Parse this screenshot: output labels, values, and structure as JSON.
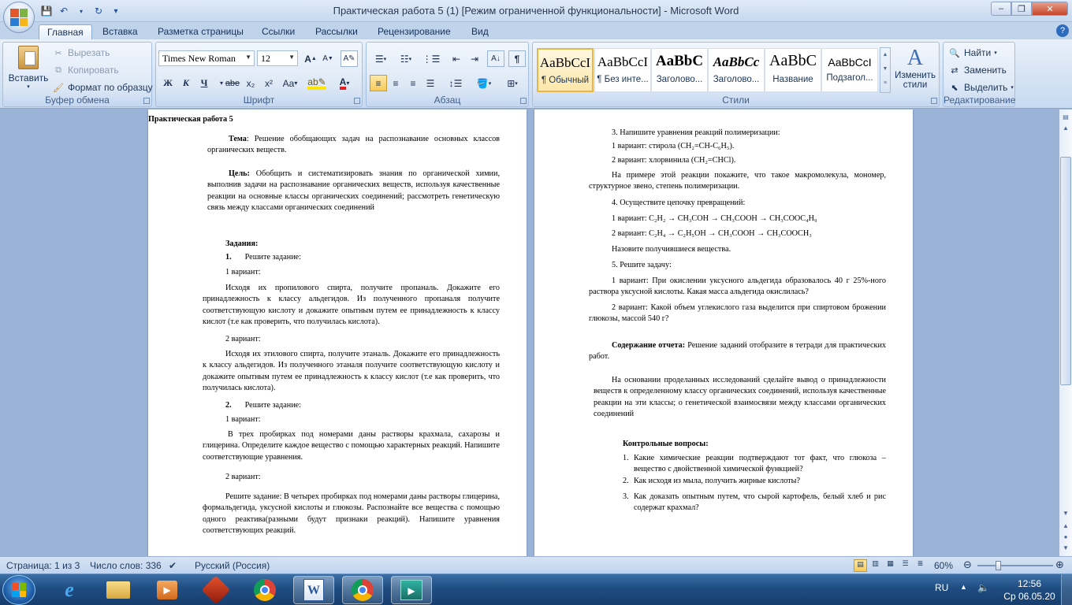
{
  "window": {
    "title": "Практическая работа 5 (1) [Режим ограниченной функциональности] - Microsoft Word",
    "min": "‒",
    "max": "❐",
    "close": "✕"
  },
  "qat": {
    "save": "💾",
    "undo": "↶",
    "redo": "↻",
    "customize": "▾"
  },
  "tabs": [
    "Главная",
    "Вставка",
    "Разметка страницы",
    "Ссылки",
    "Рассылки",
    "Рецензирование",
    "Вид"
  ],
  "clipboard": {
    "paste": "Вставить",
    "cut": "Вырезать",
    "copy": "Копировать",
    "format_painter": "Формат по образцу",
    "label": "Буфер обмена"
  },
  "font": {
    "name": "Times New Roman",
    "size": "12",
    "label": "Шрифт",
    "bold": "Ж",
    "italic": "К",
    "underline": "Ч",
    "strike": "abe",
    "sub": "x₂",
    "sup": "x²",
    "case": "Aa",
    "grow": "A",
    "shrink": "A"
  },
  "paragraph": {
    "label": "Абзац"
  },
  "styles": {
    "label": "Стили",
    "items": [
      {
        "preview": "AaBbCcI",
        "name": "¶ Обычный"
      },
      {
        "preview": "AaBbCcI",
        "name": "¶ Без инте..."
      },
      {
        "preview": "AaBbC",
        "name": "Заголово..."
      },
      {
        "preview": "AaBbCc",
        "name": "Заголово..."
      },
      {
        "preview": "AaBbC",
        "name": "Название"
      },
      {
        "preview": "AaBbCcI",
        "name": "Подзагол..."
      }
    ],
    "change": "Изменить стили"
  },
  "editing": {
    "find": "Найти",
    "replace": "Заменить",
    "select": "Выделить",
    "label": "Редактирование"
  },
  "page1": {
    "title": "Практическая работа 5",
    "topic_label": "Тема",
    "topic": ": Решение обобщающих задач на распознавание основных классов органических веществ.",
    "goal_label": "Цель:",
    "goal": " Обобщить и систематизировать знания по органической химии, выполнив задачи на распознавание органических веществ, используя качественные реакции на основные классы органических соединений; рассмотреть генетическую связь между классами органических соединений",
    "tasks": "Задания:",
    "t1_num": "1.",
    "t1": "Решите задание:",
    "v1": "1 вариант:",
    "v1_text": "Исходя их пропилового спирта, получите пропаналь. Докажите его принадлежность к классу альдегидов. Из полученного пропаналя получите соответствующую кислоту и докажите опытным путем ее принадлежность к классу кислот (т.е как проверить, что получилась кислота).",
    "v2": "2 вариант:",
    "v2_text": "Исходя их этилового спирта, получите этаналь. Докажите его принадлежность к классу альдегидов. Из полученного этаналя получите соответствующую кислоту и докажите опытным путем ее принадлежность к классу кислот (т.е как проверить, что получилась кислота).",
    "t2_num": "2.",
    "t2": "Решите задание:",
    "t2v1": "1 вариант:",
    "t2v1_text": "В трех пробирках под номерами даны растворы крахмала, сахарозы и глицерина. Определите каждое вещество с помощью характерных реакций. Напишите соответствующие уравнения.",
    "t2v2": "2 вариант:",
    "t2v2_text": "Решите задание: В четырех пробирках под номерами даны растворы глицерина, формальдегида, уксусной кислоты и глюкозы. Распознайте все вещества с помощью одного реактива(разными будут признаки реакций). Напишите уравнения соответствующих реакций."
  },
  "page2": {
    "t3": "3. Напишите уравнения реакций полимеризации:",
    "t3v1": "1 вариант: стирола (CH₂=CH-C₆H₅).",
    "t3v2": "2 вариант: хлорвинила (CH₂=CHCl).",
    "t3_text": "На примере этой реакции покажите, что такое макромолекула, мономер, структурное звено, степень полимеризации.",
    "t4": "4. Осуществите цепочку превращений:",
    "t4v1": "1 вариант: C₂H₂ → CH₃COH → CH₃COOH → CH₃COOC₄H₉",
    "t4v2": "2 вариант: C₂H₄ → C₂H₅OH → CH₃COOH → CH₃COOCH₃",
    "t4_text": "Назовите получившиеся вещества.",
    "t5": "5. Решите задачу:",
    "t5v1": "1 вариант: При окислении уксусного альдегида образовалось 40 г 25%-ного раствора уксусной кислоты. Какая масса альдегида окислилась?",
    "t5v2": "2 вариант: Какой объем углекислого газа выделится при спиртовом брожении глюкозы, массой 540 г?",
    "report_label": "Содержание отчета:",
    "report": " Решение заданий отобразите в тетради для практических работ.",
    "conclusion": "На основании проделанных исследований сделайте вывод о принадлежности веществ к определенному классу органических соединений, используя качественные реакции на эти классы; о генетической взаимосвязи между классами органических соединений",
    "questions_title": "Контрольные вопросы:",
    "q1": "Какие химические реакции подтверждают тот факт, что глюкоза – вещество с двойственной химической функцией?",
    "q2": "Как исходя из мыла, получить жирные кислоты?",
    "q3": "Как доказать опытным путем, что сырой картофель, белый хлеб и рис содержат крахмал?"
  },
  "status": {
    "page": "Страница: 1 из 3",
    "words": "Число слов: 336",
    "lang": "Русский (Россия)",
    "zoom": "60%"
  },
  "tray": {
    "lang": "RU",
    "time": "12:56",
    "date": "Ср 06.05.20"
  }
}
